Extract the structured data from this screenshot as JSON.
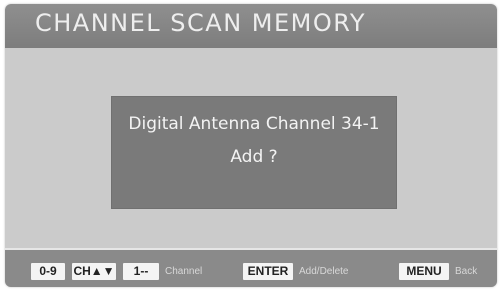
{
  "title": "CHANNEL SCAN MEMORY",
  "dialog": {
    "line1": "Digital Antenna Channel 34-1",
    "line2": "Add ?"
  },
  "footer": {
    "key_digits": "0-9",
    "key_ch": "CH▲▼",
    "key_one": "1--",
    "hint_channel": "Channel",
    "key_enter": "ENTER",
    "hint_add_delete": "Add/Delete",
    "key_menu": "MENU",
    "hint_back": "Back"
  }
}
